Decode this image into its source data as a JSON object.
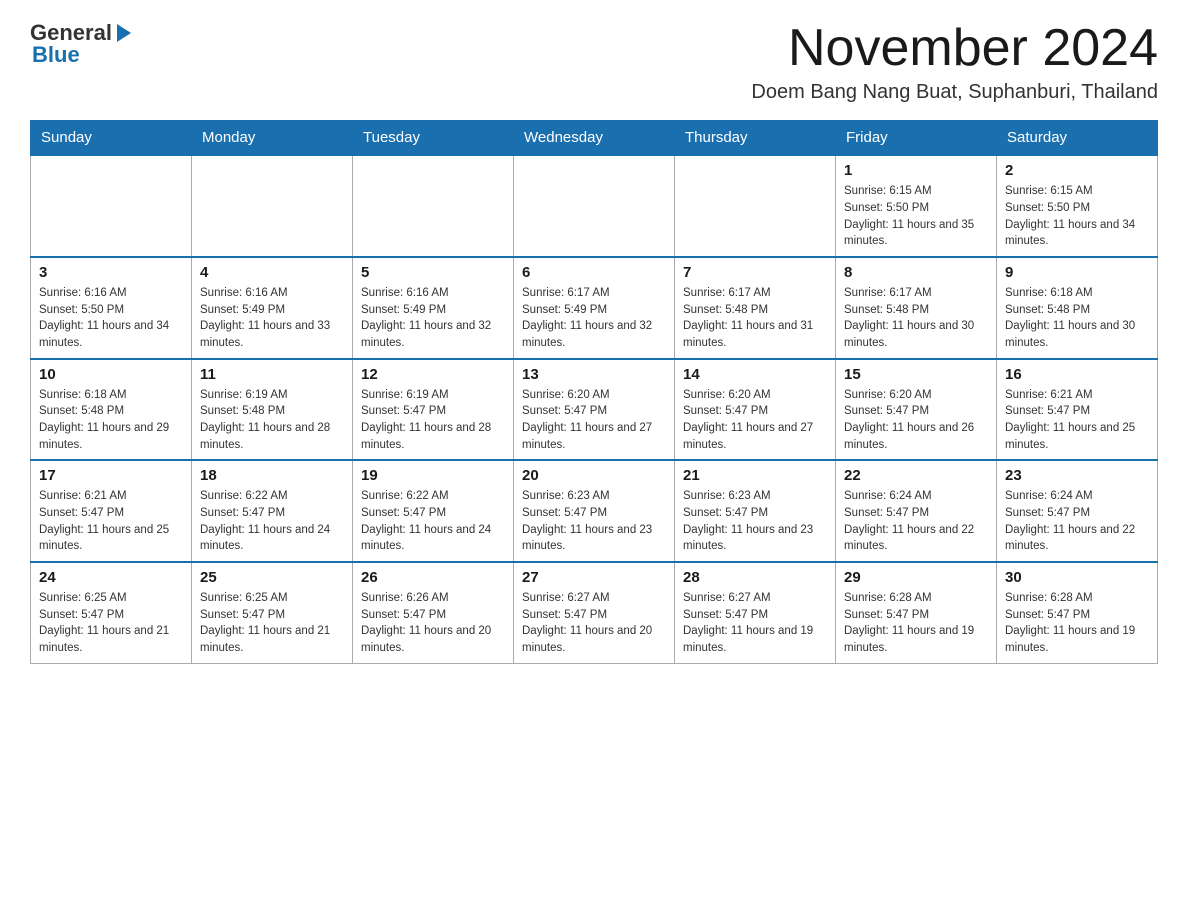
{
  "logo": {
    "text_general": "General",
    "text_blue": "Blue",
    "arrow": "▶"
  },
  "title": {
    "month_year": "November 2024",
    "location": "Doem Bang Nang Buat, Suphanburi, Thailand"
  },
  "days_of_week": [
    "Sunday",
    "Monday",
    "Tuesday",
    "Wednesday",
    "Thursday",
    "Friday",
    "Saturday"
  ],
  "weeks": [
    [
      {
        "day": "",
        "info": ""
      },
      {
        "day": "",
        "info": ""
      },
      {
        "day": "",
        "info": ""
      },
      {
        "day": "",
        "info": ""
      },
      {
        "day": "",
        "info": ""
      },
      {
        "day": "1",
        "info": "Sunrise: 6:15 AM\nSunset: 5:50 PM\nDaylight: 11 hours and 35 minutes."
      },
      {
        "day": "2",
        "info": "Sunrise: 6:15 AM\nSunset: 5:50 PM\nDaylight: 11 hours and 34 minutes."
      }
    ],
    [
      {
        "day": "3",
        "info": "Sunrise: 6:16 AM\nSunset: 5:50 PM\nDaylight: 11 hours and 34 minutes."
      },
      {
        "day": "4",
        "info": "Sunrise: 6:16 AM\nSunset: 5:49 PM\nDaylight: 11 hours and 33 minutes."
      },
      {
        "day": "5",
        "info": "Sunrise: 6:16 AM\nSunset: 5:49 PM\nDaylight: 11 hours and 32 minutes."
      },
      {
        "day": "6",
        "info": "Sunrise: 6:17 AM\nSunset: 5:49 PM\nDaylight: 11 hours and 32 minutes."
      },
      {
        "day": "7",
        "info": "Sunrise: 6:17 AM\nSunset: 5:48 PM\nDaylight: 11 hours and 31 minutes."
      },
      {
        "day": "8",
        "info": "Sunrise: 6:17 AM\nSunset: 5:48 PM\nDaylight: 11 hours and 30 minutes."
      },
      {
        "day": "9",
        "info": "Sunrise: 6:18 AM\nSunset: 5:48 PM\nDaylight: 11 hours and 30 minutes."
      }
    ],
    [
      {
        "day": "10",
        "info": "Sunrise: 6:18 AM\nSunset: 5:48 PM\nDaylight: 11 hours and 29 minutes."
      },
      {
        "day": "11",
        "info": "Sunrise: 6:19 AM\nSunset: 5:48 PM\nDaylight: 11 hours and 28 minutes."
      },
      {
        "day": "12",
        "info": "Sunrise: 6:19 AM\nSunset: 5:47 PM\nDaylight: 11 hours and 28 minutes."
      },
      {
        "day": "13",
        "info": "Sunrise: 6:20 AM\nSunset: 5:47 PM\nDaylight: 11 hours and 27 minutes."
      },
      {
        "day": "14",
        "info": "Sunrise: 6:20 AM\nSunset: 5:47 PM\nDaylight: 11 hours and 27 minutes."
      },
      {
        "day": "15",
        "info": "Sunrise: 6:20 AM\nSunset: 5:47 PM\nDaylight: 11 hours and 26 minutes."
      },
      {
        "day": "16",
        "info": "Sunrise: 6:21 AM\nSunset: 5:47 PM\nDaylight: 11 hours and 25 minutes."
      }
    ],
    [
      {
        "day": "17",
        "info": "Sunrise: 6:21 AM\nSunset: 5:47 PM\nDaylight: 11 hours and 25 minutes."
      },
      {
        "day": "18",
        "info": "Sunrise: 6:22 AM\nSunset: 5:47 PM\nDaylight: 11 hours and 24 minutes."
      },
      {
        "day": "19",
        "info": "Sunrise: 6:22 AM\nSunset: 5:47 PM\nDaylight: 11 hours and 24 minutes."
      },
      {
        "day": "20",
        "info": "Sunrise: 6:23 AM\nSunset: 5:47 PM\nDaylight: 11 hours and 23 minutes."
      },
      {
        "day": "21",
        "info": "Sunrise: 6:23 AM\nSunset: 5:47 PM\nDaylight: 11 hours and 23 minutes."
      },
      {
        "day": "22",
        "info": "Sunrise: 6:24 AM\nSunset: 5:47 PM\nDaylight: 11 hours and 22 minutes."
      },
      {
        "day": "23",
        "info": "Sunrise: 6:24 AM\nSunset: 5:47 PM\nDaylight: 11 hours and 22 minutes."
      }
    ],
    [
      {
        "day": "24",
        "info": "Sunrise: 6:25 AM\nSunset: 5:47 PM\nDaylight: 11 hours and 21 minutes."
      },
      {
        "day": "25",
        "info": "Sunrise: 6:25 AM\nSunset: 5:47 PM\nDaylight: 11 hours and 21 minutes."
      },
      {
        "day": "26",
        "info": "Sunrise: 6:26 AM\nSunset: 5:47 PM\nDaylight: 11 hours and 20 minutes."
      },
      {
        "day": "27",
        "info": "Sunrise: 6:27 AM\nSunset: 5:47 PM\nDaylight: 11 hours and 20 minutes."
      },
      {
        "day": "28",
        "info": "Sunrise: 6:27 AM\nSunset: 5:47 PM\nDaylight: 11 hours and 19 minutes."
      },
      {
        "day": "29",
        "info": "Sunrise: 6:28 AM\nSunset: 5:47 PM\nDaylight: 11 hours and 19 minutes."
      },
      {
        "day": "30",
        "info": "Sunrise: 6:28 AM\nSunset: 5:47 PM\nDaylight: 11 hours and 19 minutes."
      }
    ]
  ]
}
